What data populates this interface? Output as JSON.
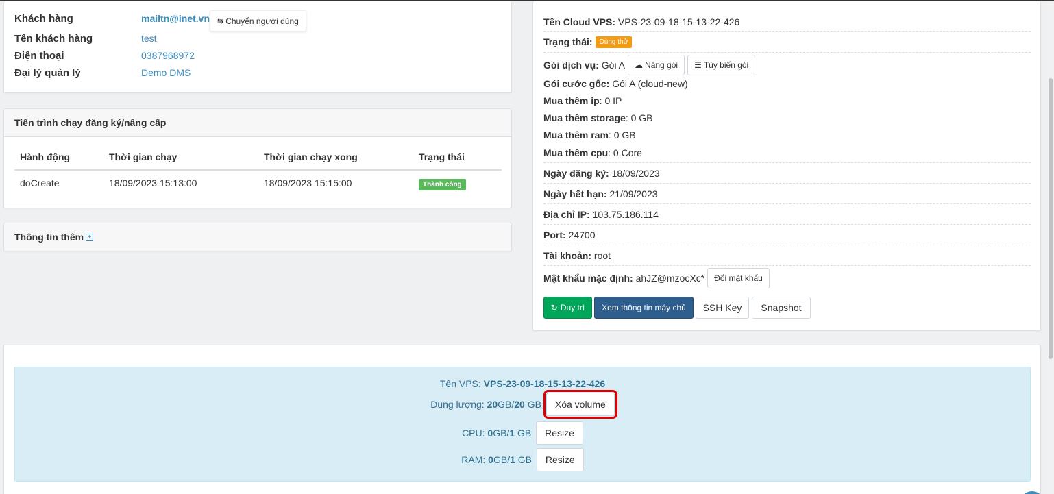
{
  "customer": {
    "rows": [
      {
        "label": "Khách hàng",
        "value": "mailtn@inet.vn"
      },
      {
        "label": "Tên khách hàng",
        "value": "test"
      },
      {
        "label": "Điện thoại",
        "value": "0387968972"
      },
      {
        "label": "Đại lý quản lý",
        "value": "Demo DMS"
      }
    ],
    "switch_user_label": "Chuyển người dùng"
  },
  "process": {
    "title": "Tiến trình chạy đăng ký/nâng cấp",
    "columns": [
      "Hành động",
      "Thời gian chạy",
      "Thời gian chạy xong",
      "Trạng thái"
    ],
    "rows": [
      {
        "action": "doCreate",
        "start": "18/09/2023 15:13:00",
        "end": "18/09/2023 15:15:00",
        "status": "Thành công"
      }
    ]
  },
  "more_info": {
    "title": "Thông tin thêm",
    "icon": "plus-square-icon"
  },
  "vps": {
    "name_label": "Tên Cloud VPS:",
    "name_value": "VPS-23-09-18-15-13-22-426",
    "status_label": "Trạng thái:",
    "status_value": "Dùng thử",
    "package_label": "Gói dịch vụ:",
    "package_value": "Gói A",
    "upgrade_label": "Nâng gói",
    "customize_label": "Tùy biến gói",
    "base_label": "Gói cước gốc:",
    "base_value": "Gói A (cloud-new)",
    "ip_label": "Mua thêm ip",
    "ip_value": ": 0 IP",
    "storage_label": "Mua thêm storage",
    "storage_value": ": 0 GB",
    "ram_label": "Mua thêm ram",
    "ram_value": ": 0 GB",
    "cpu_label": "Mua thêm cpu",
    "cpu_value": ": 0 Core",
    "reg_label": "Ngày đăng ký:",
    "reg_value": "18/09/2023",
    "exp_label": "Ngày hết hạn:",
    "exp_value": "21/09/2023",
    "ipaddr_label": "Địa chỉ IP:",
    "ipaddr_value": "103.75.186.114",
    "port_label": "Port:",
    "port_value": "24700",
    "account_label": "Tài khoản:",
    "account_value": "root",
    "password_label": "Mật khẩu mặc định:",
    "password_value": "ahJZ@mzocXc*",
    "change_password_label": "Đổi mật khẩu",
    "actions": {
      "maintain": "Duy trì",
      "server_info": "Xem thông tin máy chủ",
      "ssh_key": "SSH Key",
      "snapshot": "Snapshot"
    },
    "colors": {
      "trial": "#f39c12",
      "maintain": "#00a65a",
      "server_info": "#2e5e8e"
    }
  },
  "resources": {
    "vps_name_label": "Tên VPS:",
    "vps_name_value": "VPS-23-09-18-15-13-22-426",
    "disk_label": "Dung lượng:",
    "disk_used": "20",
    "disk_sep": "GB/",
    "disk_total": "20",
    "disk_unit": "GB",
    "delete_volume_label": "Xóa volume",
    "cpu_label": "CPU:",
    "cpu_used": "0",
    "cpu_sep": "GB/",
    "cpu_total": "1",
    "cpu_unit": "GB",
    "ram_label": "RAM:",
    "ram_used": "0",
    "ram_sep": "GB/",
    "ram_total": "1",
    "ram_unit": "GB",
    "resize_label": "Resize"
  }
}
